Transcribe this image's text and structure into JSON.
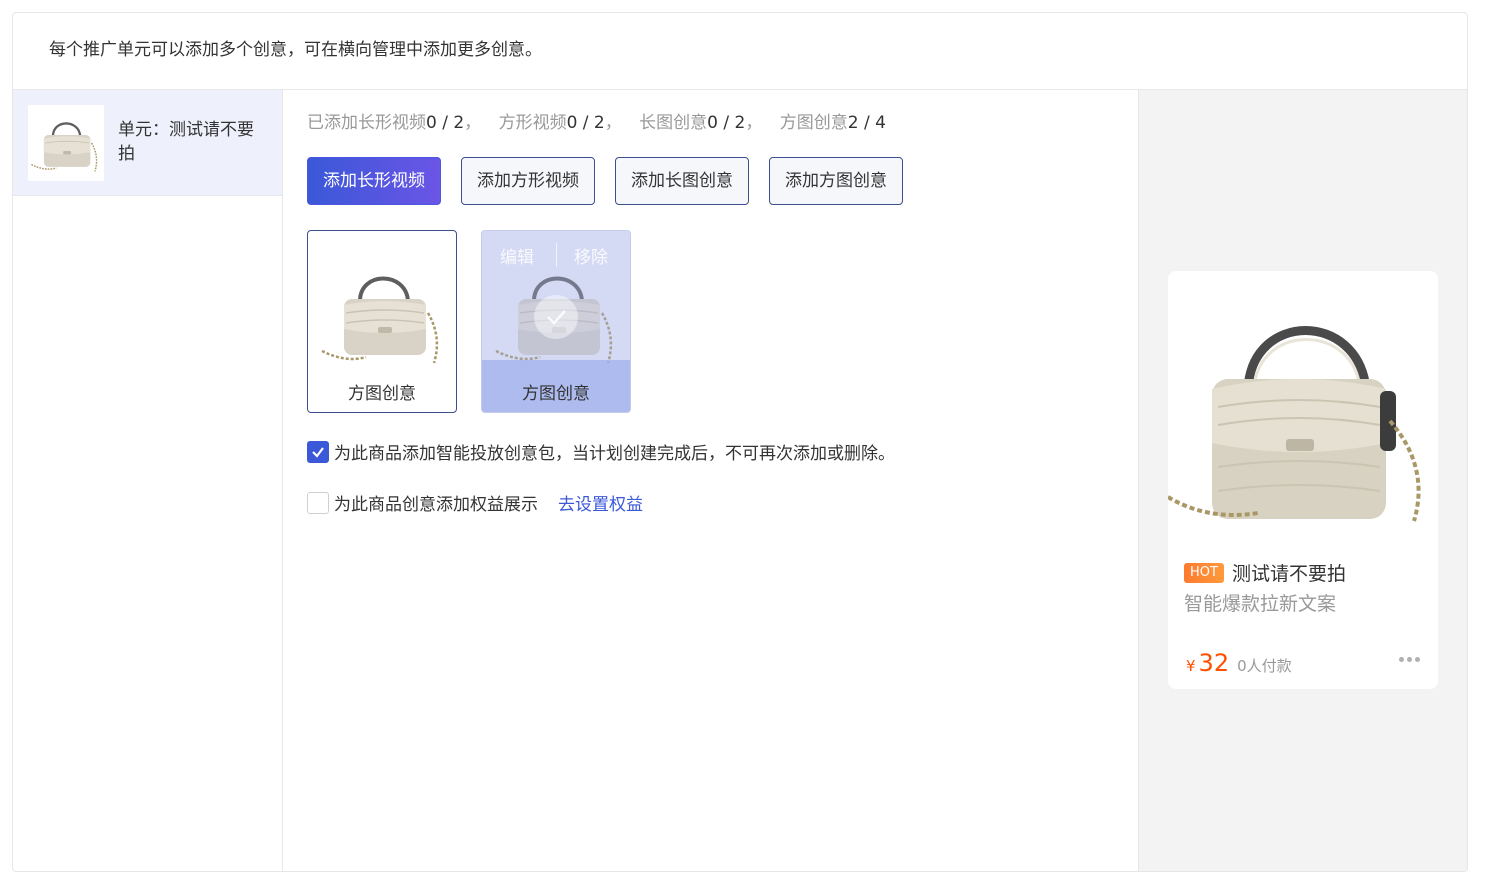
{
  "notice": "每个推广单元可以添加多个创意，可在横向管理中添加更多创意。",
  "unit": {
    "label": "单元：测试请不要拍"
  },
  "counts": {
    "long_video_label": "已添加长形视频",
    "long_video_value": "0 / 2",
    "square_video_label": "方形视频",
    "square_video_value": "0 / 2",
    "long_image_label": "长图创意",
    "long_image_value": "0 / 2",
    "square_image_label": "方图创意",
    "square_image_value": "2 / 4",
    "separator": "，"
  },
  "buttons": {
    "add_long_video": "添加长形视频",
    "add_square_video": "添加方形视频",
    "add_long_image": "添加长图创意",
    "add_square_image": "添加方图创意"
  },
  "creatives": [
    {
      "caption": "方图创意"
    },
    {
      "caption": "方图创意",
      "edit": "编辑",
      "remove": "移除"
    }
  ],
  "options": {
    "smart_pack": {
      "checked": true,
      "label": "为此商品添加智能投放创意包，当计划创建完成后，不可再次添加或删除。"
    },
    "benefit": {
      "checked": false,
      "label": "为此商品创意添加权益展示",
      "link": "去设置权益"
    }
  },
  "preview": {
    "badge": "HOT",
    "title": "测试请不要拍",
    "subtitle": "智能爆款拉新文案",
    "currency": "¥",
    "price": "32",
    "paid": "0人付款"
  },
  "colors": {
    "accent": "#3a58d8",
    "price": "#ff5000",
    "hot": "#ff7a2e"
  }
}
